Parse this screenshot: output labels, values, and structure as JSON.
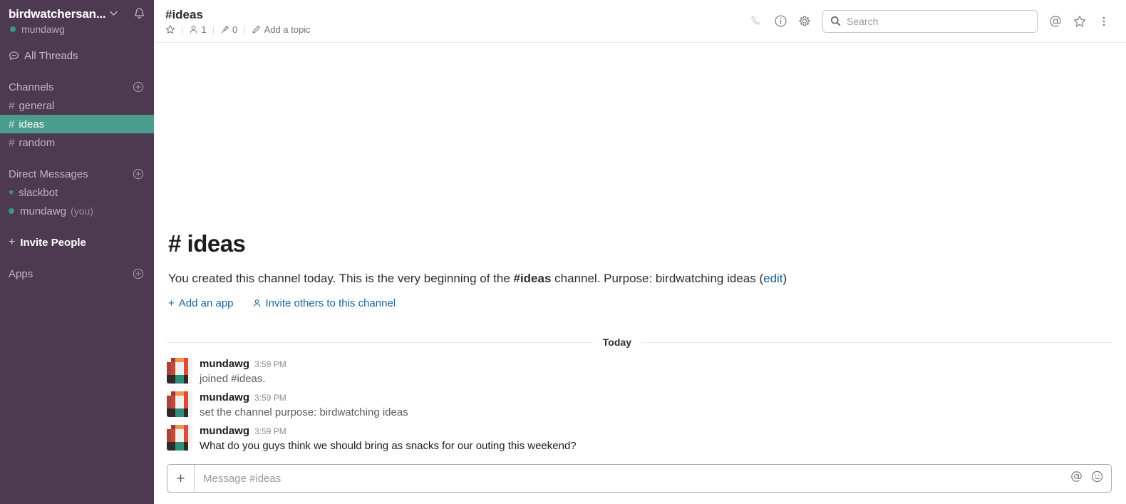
{
  "sidebar": {
    "team_name": "birdwatchersan...",
    "chevron_icon": "chevron-down-icon",
    "bell_icon": "bell-icon",
    "current_user": "mundawg",
    "all_threads_label": "All Threads",
    "threads_icon": "threads-icon",
    "channels_section": {
      "title": "Channels",
      "add_icon": "plus-circle-icon",
      "items": [
        {
          "prefix": "#",
          "label": "general",
          "active": false
        },
        {
          "prefix": "#",
          "label": "ideas",
          "active": true
        },
        {
          "prefix": "#",
          "label": "random",
          "active": false
        }
      ]
    },
    "dm_section": {
      "title": "Direct Messages",
      "add_icon": "plus-circle-icon",
      "items": [
        {
          "icon": "heart-icon",
          "label": "slackbot",
          "suffix": ""
        },
        {
          "icon": "presence-dot-icon",
          "label": "mundawg",
          "suffix": "(you)"
        }
      ]
    },
    "invite_people": {
      "label": "Invite People",
      "icon": "plus-icon"
    },
    "apps_section": {
      "title": "Apps",
      "add_icon": "plus-circle-icon"
    }
  },
  "topbar": {
    "channel_title": "#ideas",
    "star_icon": "star-outline-icon",
    "members_icon": "person-icon",
    "members_count": "1",
    "pin_icon": "pin-icon",
    "pin_count": "0",
    "topic_icon": "pencil-icon",
    "add_topic_label": "Add a topic",
    "call_icon": "phone-icon",
    "info_icon": "info-circle-icon",
    "settings_icon": "gear-icon",
    "search": {
      "icon": "search-icon",
      "placeholder": "Search",
      "value": ""
    },
    "mentions_icon": "at-icon",
    "starred_icon": "star-outline-icon",
    "more_icon": "kebab-menu-icon"
  },
  "intro": {
    "title": "# ideas",
    "text_part1": "You created this channel today. This is the very beginning of the ",
    "channel_ref": "#ideas",
    "text_part2": " channel. Purpose: birdwatching ideas (",
    "edit_link": "edit",
    "text_part3": ")",
    "add_app": {
      "label": "Add an app",
      "icon": "plus-icon"
    },
    "invite_others": {
      "label": "Invite others to this channel",
      "icon": "person-add-icon"
    }
  },
  "divider": {
    "label": "Today"
  },
  "messages": [
    {
      "avatar": "default-avatar",
      "author": "mundawg",
      "time": "3:59 PM",
      "text": "joined #ideas.",
      "emphasis": false
    },
    {
      "avatar": "default-avatar",
      "author": "mundawg",
      "time": "3:59 PM",
      "text": "set the channel purpose: birdwatching ideas",
      "emphasis": false
    },
    {
      "avatar": "default-avatar",
      "author": "mundawg",
      "time": "3:59 PM",
      "text": "What do you guys think we should bring as snacks for our outing this weekend?",
      "emphasis": true
    }
  ],
  "composer": {
    "plus_icon": "plus-icon",
    "placeholder": "Message #ideas",
    "value": "",
    "mention_icon": "at-icon",
    "emoji_icon": "emoji-smiley-icon"
  },
  "colors": {
    "sidebar_bg": "#4d3a51",
    "active_channel_bg": "#4a9c8c",
    "link_blue": "#1264a3",
    "presence_green": "#38978d"
  }
}
